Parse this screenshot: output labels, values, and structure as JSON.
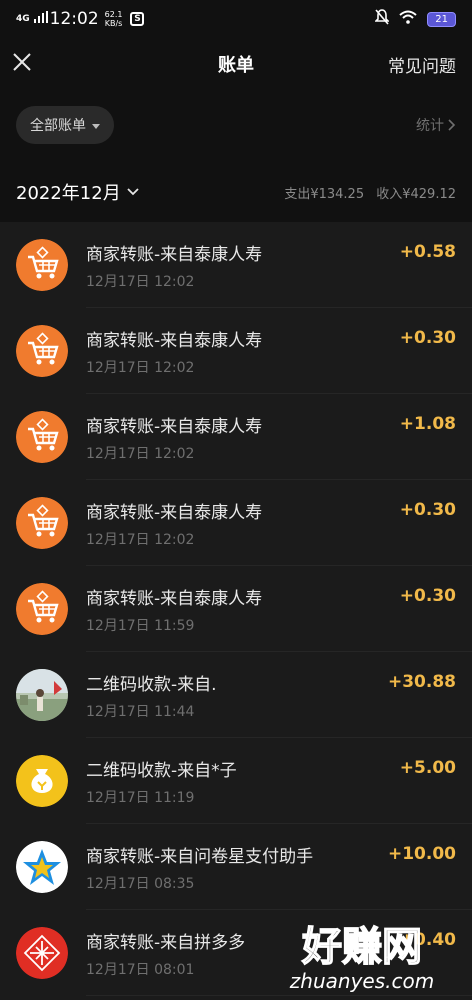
{
  "status_bar": {
    "network": "4G",
    "time": "12:02",
    "speed_value": "62.1",
    "speed_unit": "KB/s",
    "battery": "21"
  },
  "header": {
    "title": "账单",
    "faq_label": "常见问题"
  },
  "filter": {
    "all_bills_label": "全部账单",
    "stats_label": "统计"
  },
  "summary": {
    "month": "2022年12月",
    "expense": "支出¥134.25",
    "income": "收入¥429.12"
  },
  "transactions": [
    {
      "title": "商家转账-来自泰康人寿",
      "date": "12月17日 12:02",
      "amount": "+0.58",
      "icon": "shopping-cart-icon"
    },
    {
      "title": "商家转账-来自泰康人寿",
      "date": "12月17日 12:02",
      "amount": "+0.30",
      "icon": "shopping-cart-icon"
    },
    {
      "title": "商家转账-来自泰康人寿",
      "date": "12月17日 12:02",
      "amount": "+1.08",
      "icon": "shopping-cart-icon"
    },
    {
      "title": "商家转账-来自泰康人寿",
      "date": "12月17日 12:02",
      "amount": "+0.30",
      "icon": "shopping-cart-icon"
    },
    {
      "title": "商家转账-来自泰康人寿",
      "date": "12月17日 11:59",
      "amount": "+0.30",
      "icon": "shopping-cart-icon"
    },
    {
      "title": "二维码收款-来自.",
      "date": "12月17日 11:44",
      "amount": "+30.88",
      "icon": "user-photo-avatar"
    },
    {
      "title": "二维码收款-来自*子",
      "date": "12月17日 11:19",
      "amount": "+5.00",
      "icon": "money-bag-icon"
    },
    {
      "title": "商家转账-来自问卷星支付助手",
      "date": "12月17日 08:35",
      "amount": "+10.00",
      "icon": "star-icon"
    },
    {
      "title": "商家转账-来自拼多多",
      "date": "12月17日 08:01",
      "amount": "+0.40",
      "icon": "pinduoduo-logo-icon"
    }
  ],
  "watermark": {
    "text_cn": "好赚网",
    "text_url": "zhuanyes.com"
  },
  "colors": {
    "amount": "#f1b94a",
    "cart_orange": "#f07b2e",
    "bag_yellow": "#f3c21b",
    "pdd_red": "#e02e24"
  }
}
